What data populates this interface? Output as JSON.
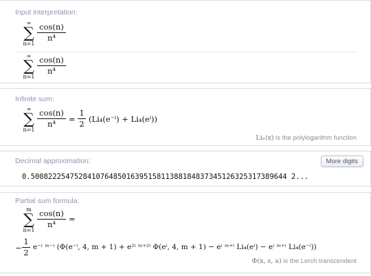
{
  "pods": {
    "input": {
      "title": "Input interpretation:",
      "row1": {
        "upper": "∞",
        "lower": "n=1",
        "numerator": "cos(n)",
        "denominator": "n⁴"
      },
      "row2": {
        "upper": "∞",
        "lower": "n=1",
        "numerator": "cos(n)",
        "denominator": "n⁴"
      }
    },
    "infinite_sum": {
      "title": "Infinite sum:",
      "upper": "∞",
      "lower": "n=1",
      "numerator": "cos(n)",
      "denominator": "n⁴",
      "equals": "=",
      "half_num": "1",
      "half_den": "2",
      "rhs": "(Li₄(e⁻ⁱ) + Li₄(eⁱ))",
      "footnote_math": "Liₙ(x)",
      "footnote_text": " is the polylogarithm function"
    },
    "decimal": {
      "title": "Decimal approximation:",
      "button": "More digits",
      "value": "0.50082225475284107648501639515811388184837345126325317389644 2..."
    },
    "partial_sum": {
      "title": "Partial sum formula:",
      "upper": "m",
      "lower": "n=1",
      "numerator": "cos(n)",
      "denominator": "n⁴",
      "equals": "=",
      "lead": "−",
      "half_num": "1",
      "half_den": "2",
      "expression": "e⁻ⁱ ᵐ⁻ⁱ (Φ(e⁻ⁱ, 4, m + 1) + e²ⁱ ᵐ⁺²ⁱ Φ(eⁱ, 4, m + 1) − eⁱ ᵐ⁺ⁱ Li₄(eⁱ) − eⁱ ᵐ⁺ⁱ Li₄(e⁻ⁱ))",
      "footnote_math": "Φ(x, s, a)",
      "footnote_text": " is the Lerch transcendent"
    }
  }
}
